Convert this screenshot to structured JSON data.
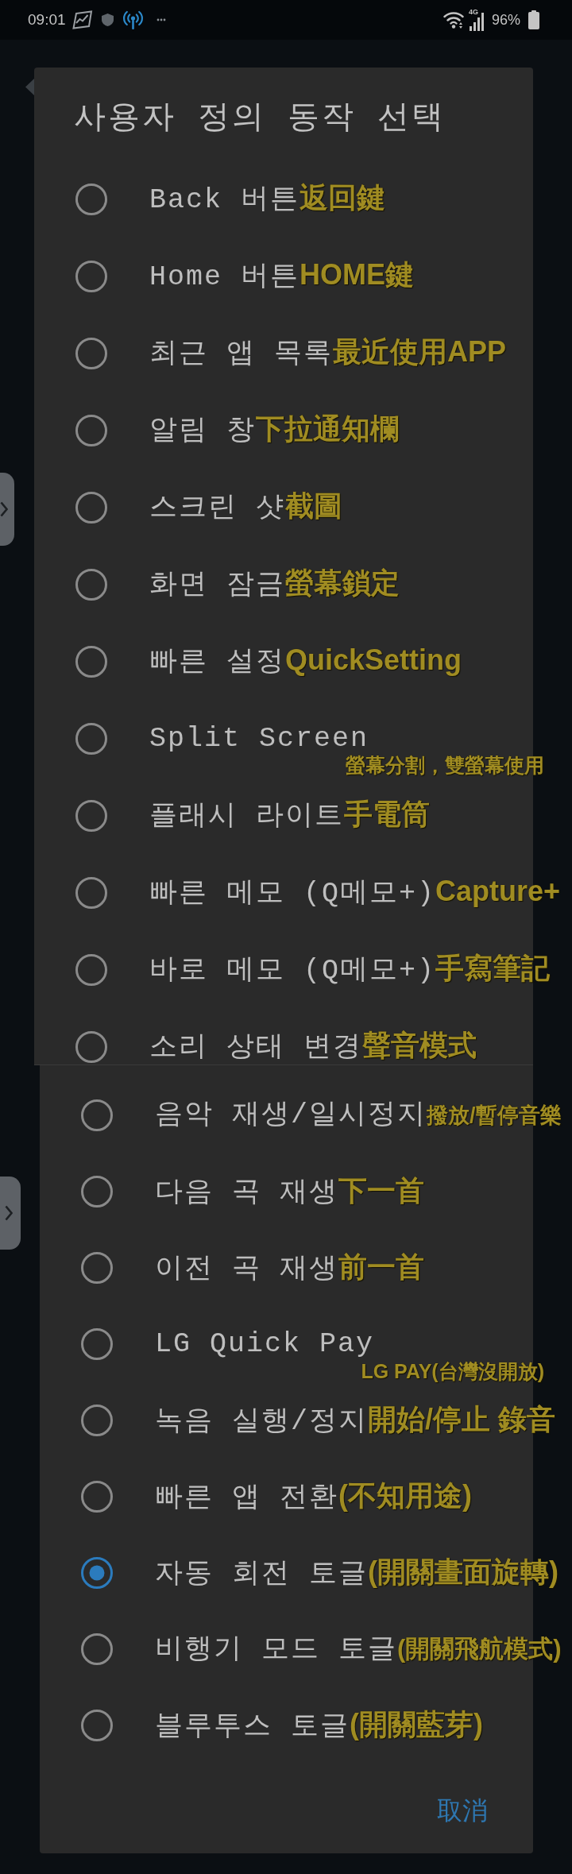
{
  "status_bar": {
    "time": "09:01",
    "network": "4G",
    "battery": "96%"
  },
  "dialog": {
    "title": "사용자 정의 동작 선택",
    "sections": [
      {
        "options": [
          {
            "label": "Back 버튼",
            "note": "返回鍵",
            "kind": "inline",
            "selected": false
          },
          {
            "label": "Home 버튼",
            "note": "HOME鍵",
            "kind": "inline",
            "selected": false
          },
          {
            "label": "최근 앱 목록",
            "note": "最近使用APP",
            "kind": "inline",
            "selected": false
          },
          {
            "label": "알림 창",
            "note": "下拉通知欄",
            "kind": "inline",
            "selected": false
          },
          {
            "label": "스크린 샷",
            "note": "截圖",
            "kind": "inline",
            "selected": false
          },
          {
            "label": "화면 잠금",
            "note": "螢幕鎖定",
            "kind": "inline",
            "selected": false
          },
          {
            "label": "빠른 설정",
            "note": "QuickSetting",
            "kind": "inline",
            "selected": false
          },
          {
            "label": "Split Screen",
            "note": "螢幕分割，雙螢幕使用",
            "kind": "stacked",
            "selected": false
          },
          {
            "label": "플래시 라이트",
            "note": "手電筒",
            "kind": "inline",
            "selected": false
          },
          {
            "label": "빠른 메모 (Q메모+)",
            "note": "Capture+",
            "kind": "inline",
            "selected": false
          },
          {
            "label": "바로 메모 (Q메모+)",
            "note": "手寫筆記",
            "kind": "inline",
            "selected": false
          },
          {
            "label": "소리 상태 변경",
            "note": "聲音模式",
            "kind": "inline",
            "selected": false
          }
        ]
      },
      {
        "options": [
          {
            "label": "음악 재생/일시정지",
            "note": "撥放/暫停音樂",
            "kind": "inline",
            "selected": false
          },
          {
            "label": "다음 곡 재생",
            "note": "下一首",
            "kind": "inline",
            "selected": false
          },
          {
            "label": "이전 곡 재생",
            "note": "前一首",
            "kind": "inline",
            "selected": false
          },
          {
            "label": "LG Quick Pay",
            "note": "LG PAY(台灣沒開放)",
            "kind": "stacked",
            "selected": false
          },
          {
            "label": "녹음 실행/정지",
            "note": "開始/停止 錄音",
            "kind": "inline",
            "selected": false
          },
          {
            "label": "빠른 앱 전환",
            "note": "(不知用途)",
            "kind": "inline",
            "selected": false
          },
          {
            "label": "자동 회전 토글",
            "note": "(開關畫面旋轉)",
            "kind": "inline",
            "selected": true
          },
          {
            "label": "비행기 모드 토글",
            "note": "(開關飛航模式)",
            "kind": "inline",
            "selected": false
          },
          {
            "label": "블루투스 토글",
            "note": "(開關藍芽)",
            "kind": "inline",
            "selected": false
          }
        ]
      }
    ],
    "cancel_button": "取消"
  }
}
